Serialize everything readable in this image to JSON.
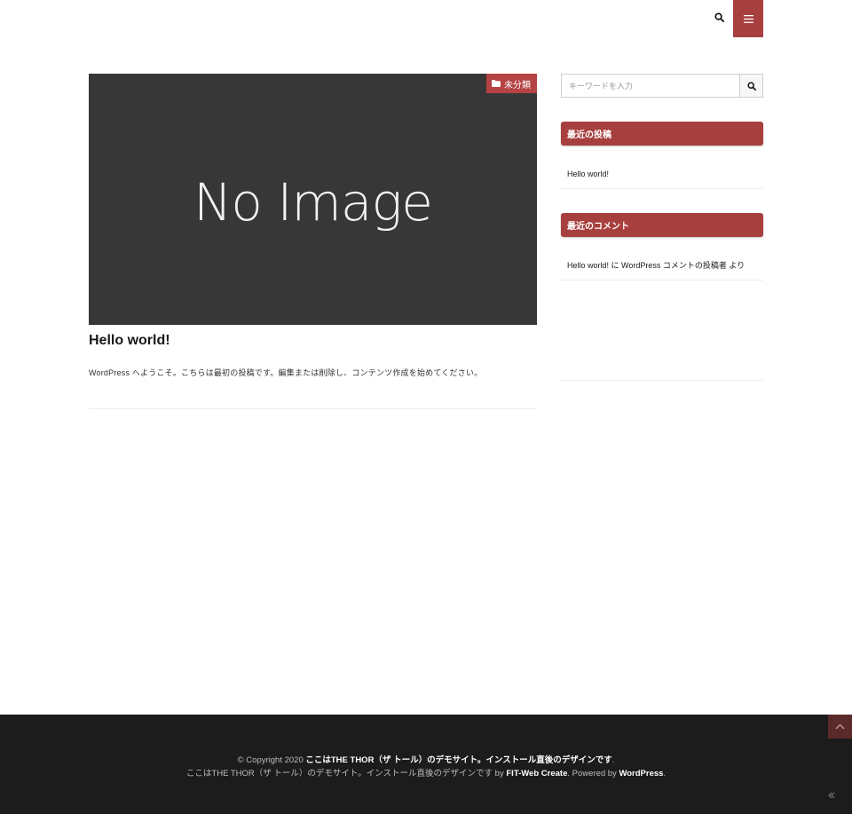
{
  "header": {
    "search_icon": "search-icon",
    "menu_icon": "hamburger-menu-icon",
    "accent_color": "#a83f3f"
  },
  "article": {
    "eyecatch_text": "No Image",
    "category": "未分類",
    "category_icon": "folder-icon",
    "title": "Hello world!",
    "excerpt": "WordPress へようこそ。こちらは最初の投稿です。編集または削除し、コンテンツ作成を始めてください。"
  },
  "sidebar": {
    "search_placeholder": "キーワードを入力",
    "recent_posts": {
      "heading": "最近の投稿",
      "items": [
        "Hello world!"
      ]
    },
    "recent_comments": {
      "heading": "最近のコメント",
      "items": [
        {
          "post": "Hello world!",
          "connector": " に ",
          "author": "WordPress コメントの投稿者",
          "suffix": " より"
        }
      ]
    }
  },
  "footer": {
    "copyright_prefix": "© Copyright 2020 ",
    "site_name": "ここはTHE THOR（ザ トール）のデモサイト。インストール直後のデザインです",
    "copyright_suffix": ".",
    "line2_prefix": "ここはTHE THOR（ザ トール）のデモサイト。インストール直後のデザインです by ",
    "fit_link": "FIT-Web Create",
    "powered_by": ". Powered by ",
    "wp_link": "WordPress",
    "line2_suffix": ".",
    "bg_color": "#1c1c1c"
  }
}
